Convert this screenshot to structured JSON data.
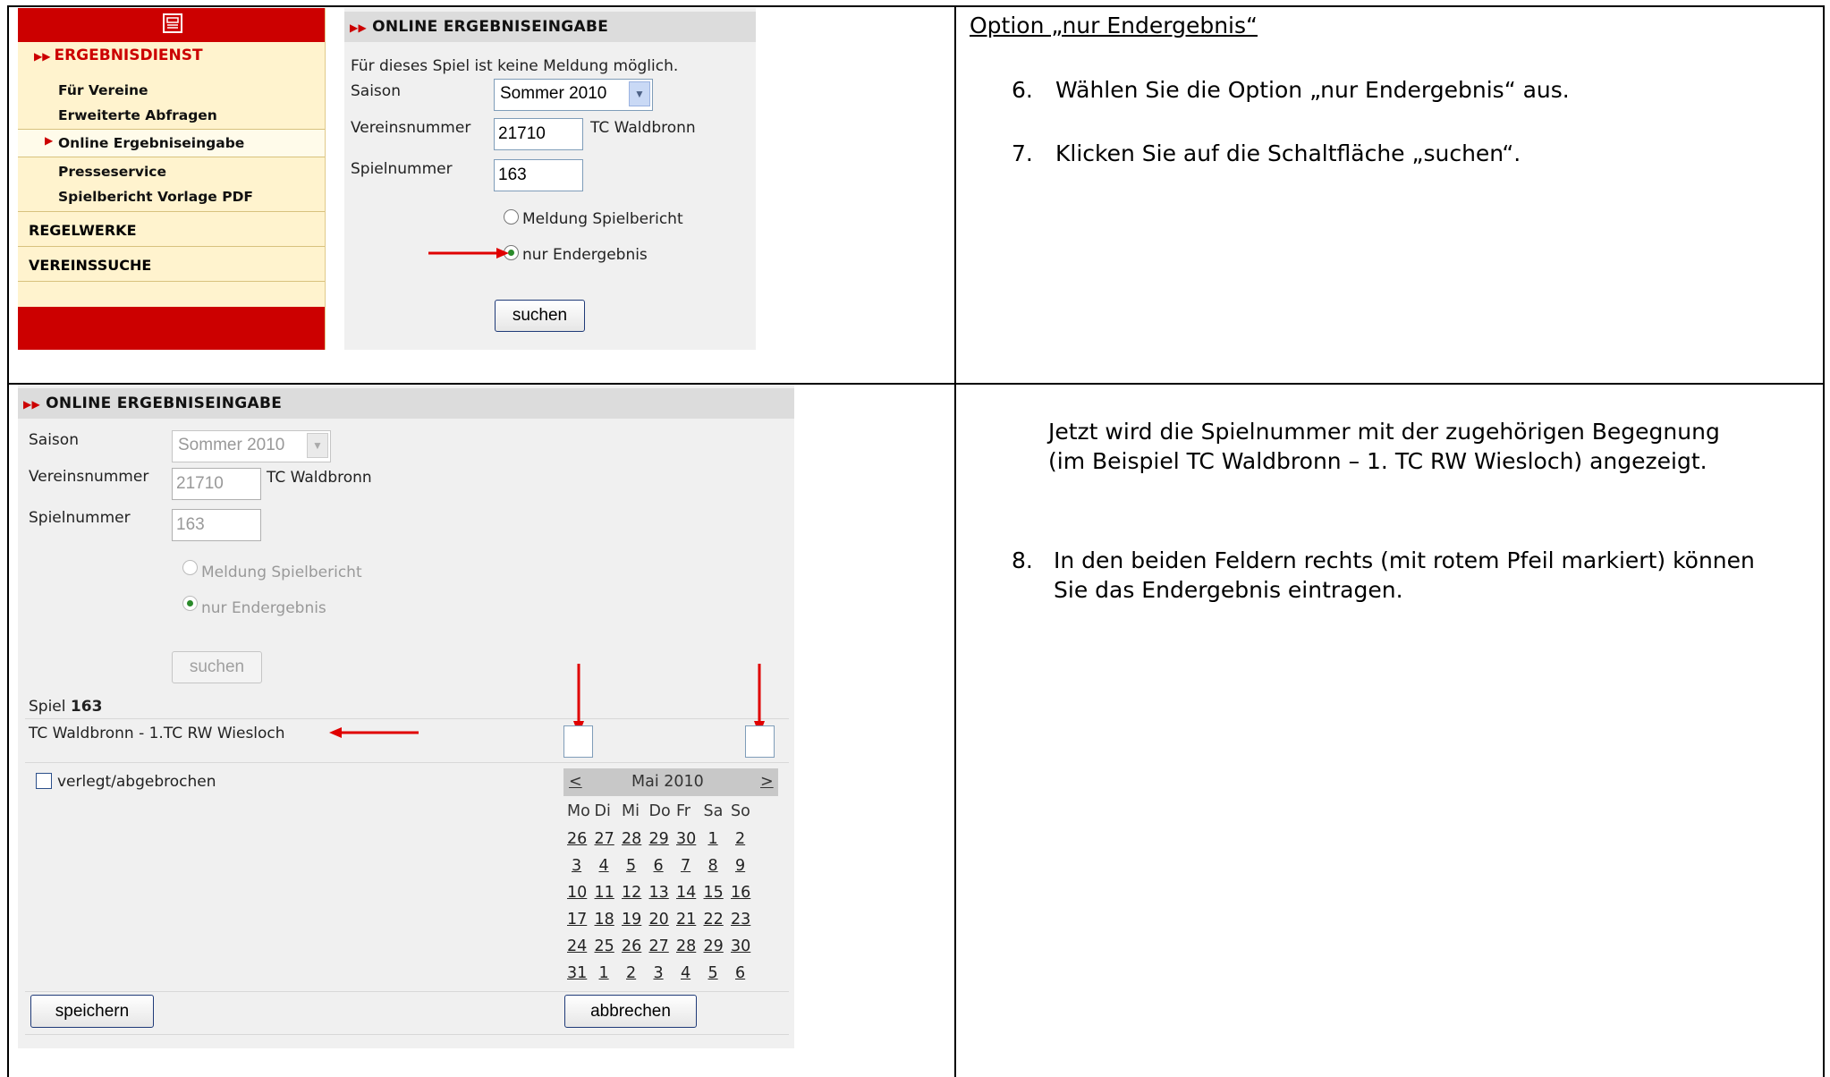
{
  "step1": {
    "menu": {
      "ergebnisdienst": "ERGEBNISDIENST",
      "items": [
        "Für Vereine",
        "Erweiterte Abfragen",
        "Online Ergebniseingabe",
        "Presseservice",
        "Spielbericht Vorlage PDF"
      ],
      "regelwerke": "REGELWERKE",
      "vereinssuche": "VEREINSSUCHE",
      "print_icon": "printer-icon"
    },
    "form": {
      "header": "ONLINE ERGEBNISEINGABE",
      "notice": "Für dieses Spiel ist keine Meldung möglich.",
      "saison_label": "Saison",
      "saison_value": "Sommer 2010",
      "vereinsnummer_label": "Vereinsnummer",
      "vereinsnummer_value": "21710",
      "verein_name": "TC Waldbronn",
      "spielnummer_label": "Spielnummer",
      "spielnummer_value": "163",
      "option_meldung": "Meldung Spielbericht",
      "option_endergebnis": "nur Endergebnis",
      "suchen": "suchen"
    }
  },
  "instructions1": {
    "heading": "Option „nur Endergebnis“",
    "step6_num": "6.",
    "step6": "Wählen Sie die Option „nur Endergebnis“ aus.",
    "step7_num": "7.",
    "step7": "Klicken Sie auf die Schaltfläche „suchen“."
  },
  "step2": {
    "form": {
      "header": "ONLINE ERGEBNISEINGABE",
      "saison_label": "Saison",
      "saison_value": "Sommer 2010",
      "vereinsnummer_label": "Vereinsnummer",
      "vereinsnummer_value": "21710",
      "verein_name": "TC Waldbronn",
      "spielnummer_label": "Spielnummer",
      "spielnummer_value": "163",
      "option_meldung": "Meldung Spielbericht",
      "option_endergebnis": "nur Endergebnis",
      "suchen": "suchen",
      "spiel_label": "Spiel",
      "spiel_num": "163",
      "match": "TC Waldbronn - 1.TC RW Wiesloch",
      "verlegt": "verlegt/abgebrochen",
      "speichern": "speichern",
      "abbrechen": "abbrechen"
    },
    "calendar": {
      "prev": "<",
      "next": ">",
      "month": "Mai 2010",
      "weekdays": [
        "Mo",
        "Di",
        "Mi",
        "Do",
        "Fr",
        "Sa",
        "So"
      ],
      "weeks": [
        [
          "26",
          "27",
          "28",
          "29",
          "30",
          "1",
          "2"
        ],
        [
          "3",
          "4",
          "5",
          "6",
          "7",
          "8",
          "9"
        ],
        [
          "10",
          "11",
          "12",
          "13",
          "14",
          "15",
          "16"
        ],
        [
          "17",
          "18",
          "19",
          "20",
          "21",
          "22",
          "23"
        ],
        [
          "24",
          "25",
          "26",
          "27",
          "28",
          "29",
          "30"
        ],
        [
          "31",
          "1",
          "2",
          "3",
          "4",
          "5",
          "6"
        ]
      ]
    }
  },
  "instructions2": {
    "intro": "Jetzt wird die Spielnummer mit der zugehörigen Begegnung (im Beispiel TC Waldbronn – 1. TC RW Wiesloch) angezeigt.",
    "step8_num": "8.",
    "step8": "In den beiden Feldern rechts (mit rotem Pfeil markiert) können Sie das Endergebnis eintragen."
  }
}
